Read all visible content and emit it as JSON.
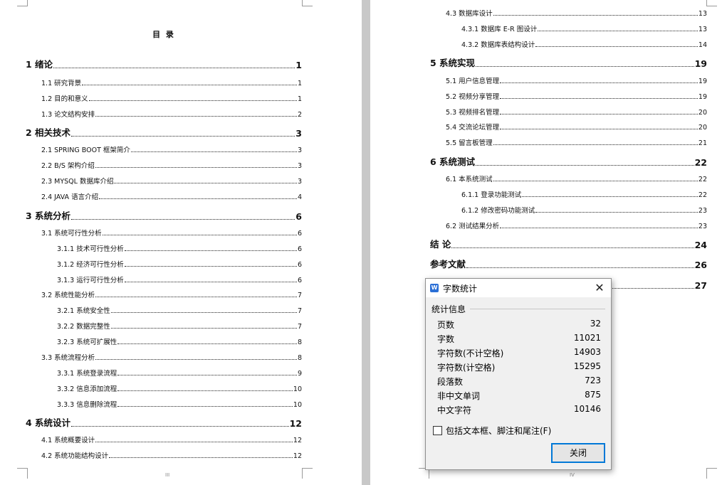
{
  "left_page": {
    "title": "目 录",
    "entries": [
      {
        "level": 1,
        "text": "1 绪论",
        "page": "1"
      },
      {
        "level": 2,
        "text": "1.1 研究背景",
        "page": "1"
      },
      {
        "level": 2,
        "text": "1.2 目的和意义",
        "page": "1"
      },
      {
        "level": 2,
        "text": "1.3 论文结构安排",
        "page": "2"
      },
      {
        "level": 1,
        "text": "2 相关技术",
        "page": "3"
      },
      {
        "level": 2,
        "text": "2.1 SPRING BOOT 框架简介",
        "page": "3"
      },
      {
        "level": 2,
        "text": "2.2 B/S 架构介绍",
        "page": "3"
      },
      {
        "level": 2,
        "text": "2.3 MYSQL 数据库介绍",
        "page": "3"
      },
      {
        "level": 2,
        "text": "2.4 JAVA 语言介绍",
        "page": "4"
      },
      {
        "level": 1,
        "text": "3 系统分析",
        "page": "6"
      },
      {
        "level": 2,
        "text": "3.1 系统可行性分析",
        "page": "6"
      },
      {
        "level": 3,
        "text": "3.1.1 技术可行性分析",
        "page": "6"
      },
      {
        "level": 3,
        "text": "3.1.2 经济可行性分析",
        "page": "6"
      },
      {
        "level": 3,
        "text": "3.1.3 运行可行性分析",
        "page": "6"
      },
      {
        "level": 2,
        "text": "3.2 系统性能分析",
        "page": "7"
      },
      {
        "level": 3,
        "text": "3.2.1 系统安全性",
        "page": "7"
      },
      {
        "level": 3,
        "text": "3.2.2 数据完整性",
        "page": "7"
      },
      {
        "level": 3,
        "text": "3.2.3 系统可扩展性",
        "page": "8"
      },
      {
        "level": 2,
        "text": "3.3 系统流程分析",
        "page": "8"
      },
      {
        "level": 3,
        "text": "3.3.1 系统登录流程",
        "page": "9"
      },
      {
        "level": 3,
        "text": "3.3.2 信息添加流程",
        "page": "10"
      },
      {
        "level": 3,
        "text": "3.3.3 信息删除流程",
        "page": "10"
      },
      {
        "level": 1,
        "text": "4 系统设计",
        "page": "12"
      },
      {
        "level": 2,
        "text": "4.1 系统概要设计",
        "page": "12"
      },
      {
        "level": 2,
        "text": "4.2 系统功能结构设计",
        "page": "12"
      }
    ],
    "page_number": "III"
  },
  "right_page": {
    "entries": [
      {
        "level": 2,
        "text": "4.3 数据库设计",
        "page": "13"
      },
      {
        "level": 3,
        "text": "4.3.1 数据库 E-R 图设计",
        "page": "13"
      },
      {
        "level": 3,
        "text": "4.3.2 数据库表结构设计",
        "page": "14"
      },
      {
        "level": 1,
        "text": "5 系统实现",
        "page": "19"
      },
      {
        "level": 2,
        "text": "5.1 用户信息管理",
        "page": "19"
      },
      {
        "level": 2,
        "text": "5.2 视频分享管理",
        "page": "19"
      },
      {
        "level": 2,
        "text": "5.3 视频排名管理",
        "page": "20"
      },
      {
        "level": 2,
        "text": "5.4 交流论坛管理",
        "page": "20"
      },
      {
        "level": 2,
        "text": "5.5 留言板管理",
        "page": "21"
      },
      {
        "level": 1,
        "text": "6 系统测试",
        "page": "22"
      },
      {
        "level": 2,
        "text": "6.1 本系统测试",
        "page": "22"
      },
      {
        "level": 3,
        "text": "6.1.1 登录功能测试",
        "page": "22"
      },
      {
        "level": 3,
        "text": "6.1.2 修改密码功能测试",
        "page": "23"
      },
      {
        "level": 2,
        "text": "6.2 测试结果分析",
        "page": "23"
      },
      {
        "level": 1,
        "text": "结 论",
        "page": "24"
      },
      {
        "level": 1,
        "text": "参考文献",
        "page": "26"
      },
      {
        "level": 1,
        "text": "",
        "page": "27"
      }
    ],
    "page_number": "IV"
  },
  "dialog": {
    "title": "字数统计",
    "app_icon": "W",
    "close_icon": "✕",
    "group_label": "统计信息",
    "stats": [
      {
        "label": "页数",
        "value": "32"
      },
      {
        "label": "字数",
        "value": "11021"
      },
      {
        "label": "字符数(不计空格)",
        "value": "14903"
      },
      {
        "label": "字符数(计空格)",
        "value": "15295"
      },
      {
        "label": "段落数",
        "value": "723"
      },
      {
        "label": "非中文单词",
        "value": "875"
      },
      {
        "label": "中文字符",
        "value": "10146"
      }
    ],
    "checkbox_label": "包括文本框、脚注和尾注(F)",
    "checkbox_checked": false,
    "close_button": "关闭",
    "accent_color": "#0078d7"
  }
}
